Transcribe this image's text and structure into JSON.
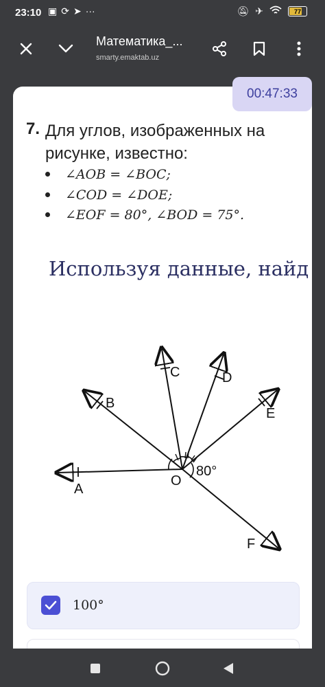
{
  "status": {
    "time": "23:10",
    "left_icons": [
      "sim-icon",
      "sync-icon",
      "telegram-icon",
      "more-dots-icon"
    ],
    "right_icons": [
      "mute-icon",
      "airplane-icon",
      "wifi-icon"
    ],
    "battery": "77"
  },
  "appbar": {
    "title": "Математика_...",
    "subtitle": "smarty.emaktab.uz"
  },
  "timer": "00:47:33",
  "question": {
    "number": "7.",
    "text": "Для углов, изображенных на рисунке, известно:",
    "conditions": [
      "∠AOB = ∠BOC;",
      "∠COD = ∠DOE;",
      "∠EOF = 80°, ∠BOD = 75°."
    ],
    "instruction": "Используя данные, найд"
  },
  "figure": {
    "labels": [
      "A",
      "B",
      "C",
      "D",
      "E",
      "F",
      "O"
    ],
    "angle_label": "80°"
  },
  "answers": [
    {
      "label": "100°",
      "checked": true
    }
  ],
  "colors": {
    "accent": "#4b4fd4",
    "timer_bg": "#d9d6f4",
    "instruction_text": "#2b2f62"
  }
}
